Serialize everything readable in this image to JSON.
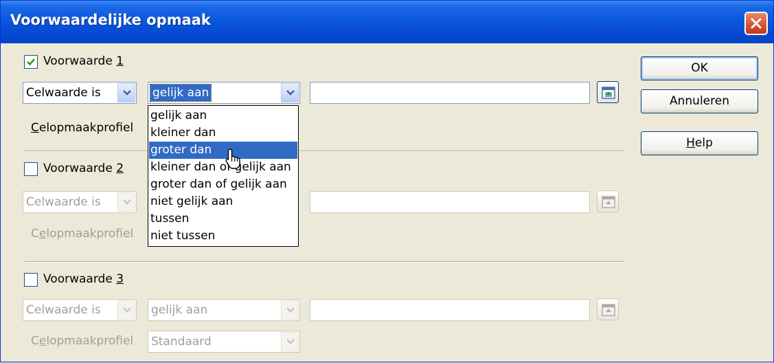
{
  "dialog": {
    "title": "Voorwaardelijke opmaak"
  },
  "conditions": [
    {
      "label_pre": "Voorwaarde ",
      "label_num": "1",
      "checked": true,
      "type_value": "Celwaarde is",
      "operator_value": "gelijk aan",
      "style_pre": "",
      "style_u": "C",
      "style_post": "elopmaakprofiel"
    },
    {
      "label_pre": "Voorwaarde ",
      "label_num": "2",
      "checked": false,
      "type_value": "Celwaarde is",
      "style_pre": "C",
      "style_u": "e",
      "style_post": "lopmaakprofiel"
    },
    {
      "label_pre": "Voorwaarde ",
      "label_num": "3",
      "checked": false,
      "type_value": "Celwaarde is",
      "operator_value": "gelijk aan",
      "style_pre": "C",
      "style_u": "e",
      "style_post": "lopmaakprofiel",
      "style_value": "Standaard"
    }
  ],
  "dropdown": {
    "options": [
      "gelijk aan",
      "kleiner dan",
      "groter dan",
      "kleiner dan of gelijk aan",
      "groter dan of gelijk aan",
      "niet gelijk aan",
      "tussen",
      "niet tussen"
    ],
    "highlighted_index": 2
  },
  "buttons": {
    "ok": "OK",
    "cancel": "Annuleren",
    "help_u": "H",
    "help_rest": "elp"
  },
  "colors": {
    "titlebar": "#0549d2",
    "selection": "#316ac5",
    "dialog_bg": "#ece9d8"
  }
}
